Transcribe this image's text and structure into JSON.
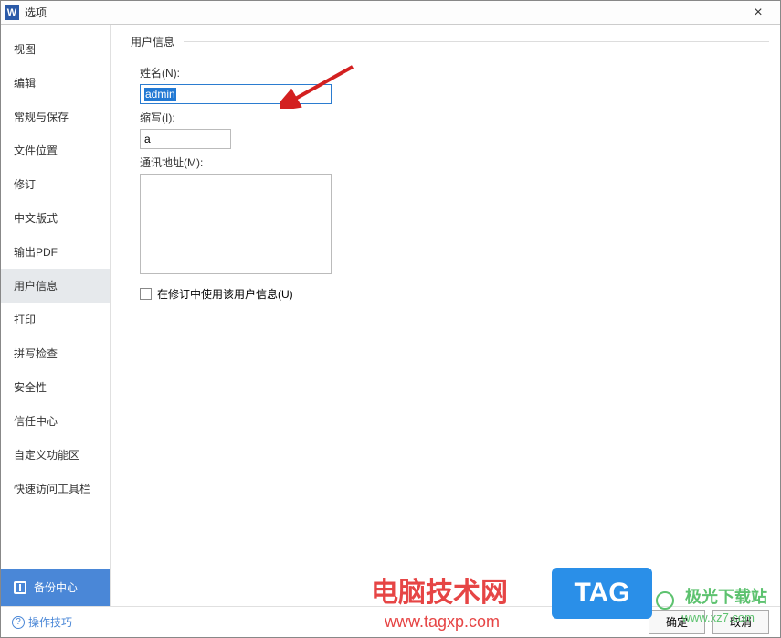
{
  "window": {
    "app_letter": "W",
    "title": "选项",
    "close": "×"
  },
  "sidebar": {
    "items": [
      {
        "label": "视图"
      },
      {
        "label": "编辑"
      },
      {
        "label": "常规与保存"
      },
      {
        "label": "文件位置"
      },
      {
        "label": "修订"
      },
      {
        "label": "中文版式"
      },
      {
        "label": "输出PDF"
      },
      {
        "label": "用户信息"
      },
      {
        "label": "打印"
      },
      {
        "label": "拼写检查"
      },
      {
        "label": "安全性"
      },
      {
        "label": "信任中心"
      },
      {
        "label": "自定义功能区"
      },
      {
        "label": "快速访问工具栏"
      }
    ],
    "selected_index": 7,
    "backup_center": "备份中心"
  },
  "panel": {
    "section_title": "用户信息",
    "name_label": "姓名(N):",
    "name_value": "admin",
    "initials_label": "缩写(I):",
    "initials_value": "a",
    "address_label": "通讯地址(M):",
    "address_value": "",
    "checkbox_label": "在修订中使用该用户信息(U)"
  },
  "footer": {
    "tips": "操作技巧",
    "ok": "确定",
    "cancel": "取消"
  },
  "watermarks": {
    "w1_main": "电脑技术网",
    "w1_sub": "www.tagxp.com",
    "tag": "TAG",
    "w2_main": "极光下载站",
    "w2_sub": "www.xz7.com"
  }
}
